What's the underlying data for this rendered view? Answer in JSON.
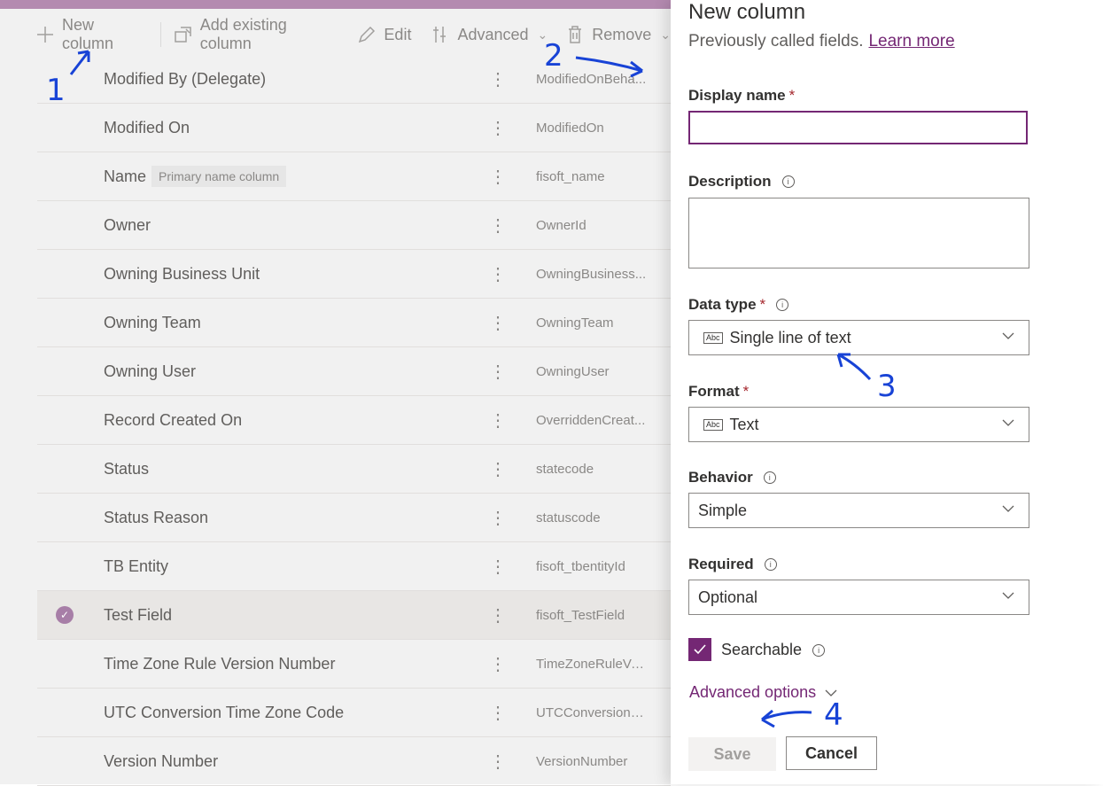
{
  "toolbar": {
    "new_column": "New column",
    "add_existing": "Add existing column",
    "edit": "Edit",
    "advanced": "Advanced",
    "remove": "Remove"
  },
  "rows": [
    {
      "name": "Modified By (Delegate)",
      "system": "ModifiedOnBeha...",
      "tag": "",
      "selected": false
    },
    {
      "name": "Modified On",
      "system": "ModifiedOn",
      "tag": "",
      "selected": false
    },
    {
      "name": "Name",
      "system": "fisoft_name",
      "tag": "Primary name column",
      "selected": false
    },
    {
      "name": "Owner",
      "system": "OwnerId",
      "tag": "",
      "selected": false
    },
    {
      "name": "Owning Business Unit",
      "system": "OwningBusiness...",
      "tag": "",
      "selected": false
    },
    {
      "name": "Owning Team",
      "system": "OwningTeam",
      "tag": "",
      "selected": false
    },
    {
      "name": "Owning User",
      "system": "OwningUser",
      "tag": "",
      "selected": false
    },
    {
      "name": "Record Created On",
      "system": "OverriddenCreat...",
      "tag": "",
      "selected": false
    },
    {
      "name": "Status",
      "system": "statecode",
      "tag": "",
      "selected": false
    },
    {
      "name": "Status Reason",
      "system": "statuscode",
      "tag": "",
      "selected": false
    },
    {
      "name": "TB Entity",
      "system": "fisoft_tbentityId",
      "tag": "",
      "selected": false
    },
    {
      "name": "Test Field",
      "system": "fisoft_TestField",
      "tag": "",
      "selected": true
    },
    {
      "name": "Time Zone Rule Version Number",
      "system": "TimeZoneRuleVe...",
      "tag": "",
      "selected": false
    },
    {
      "name": "UTC Conversion Time Zone Code",
      "system": "UTCConversionTi...",
      "tag": "",
      "selected": false
    },
    {
      "name": "Version Number",
      "system": "VersionNumber",
      "tag": "",
      "selected": false
    }
  ],
  "panel": {
    "title": "New column",
    "subtitle": "Previously called fields.",
    "learn_more": "Learn more",
    "display_name_label": "Display name",
    "display_name_value": "",
    "description_label": "Description",
    "data_type_label": "Data type",
    "data_type_value": "Single line of text",
    "format_label": "Format",
    "format_value": "Text",
    "behavior_label": "Behavior",
    "behavior_value": "Simple",
    "required_label": "Required",
    "required_value": "Optional",
    "searchable_label": "Searchable",
    "searchable_checked": true,
    "advanced_options": "Advanced options",
    "save": "Save",
    "cancel": "Cancel",
    "required_marker": "*",
    "type_icon_text": "Abc"
  },
  "annotations": [
    "1",
    "2",
    "3",
    "4"
  ],
  "colors": {
    "accent": "#742774",
    "annotation": "#1843d6",
    "header": "#b48ab0"
  }
}
